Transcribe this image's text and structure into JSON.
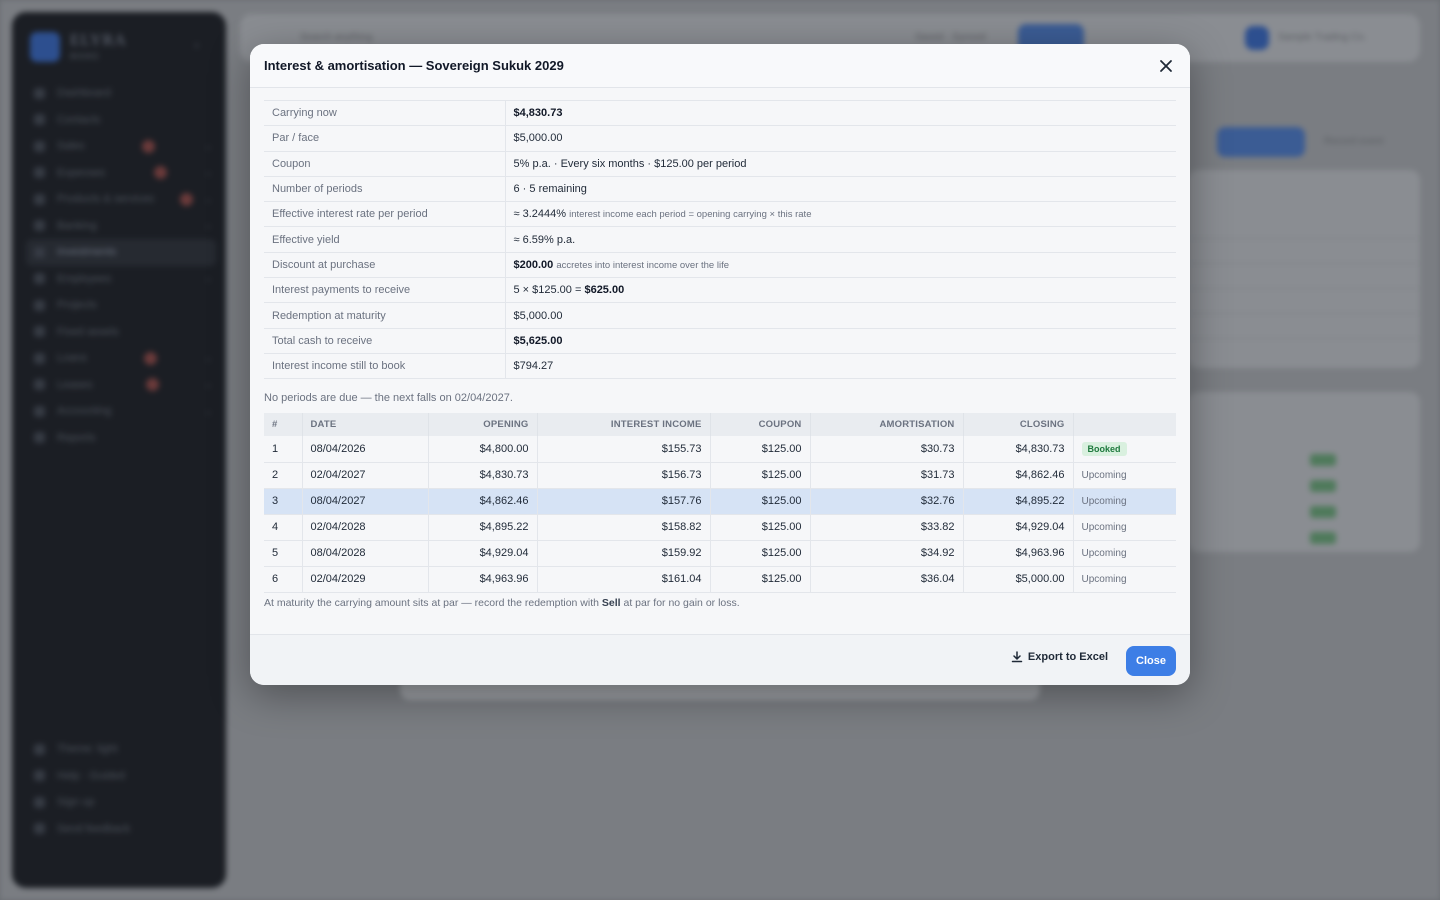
{
  "background": {
    "brand": "ELYRA",
    "brand_sub": "BOOKS",
    "nav": [
      "Dashboard",
      "Contacts",
      "Sales",
      "Expenses",
      "Products & services",
      "Banking",
      "Investments",
      "Employees",
      "Projects",
      "Fixed assets",
      "Loans",
      "Leases",
      "Accounting",
      "Reports"
    ],
    "nav_bottom": [
      "Theme: light",
      "Help · Guided",
      "Sign up",
      "Send feedback"
    ],
    "topbar": {
      "search_placeholder": "Search anything",
      "saved_text": "Saved · Synced",
      "new_label": "+ New",
      "company": "Sample Trading Co."
    },
    "actions": {
      "purchase_label": "Purchase",
      "record_label": "Record event"
    }
  },
  "modal": {
    "title": "Interest & amortisation — Sovereign Sukuk 2029",
    "summary": {
      "carrying_now": {
        "label": "Carrying now",
        "value": "$4,830.73"
      },
      "par": {
        "label": "Par / face",
        "value": "$5,000.00"
      },
      "coupon": {
        "label": "Coupon",
        "value": "5% p.a. · Every six months · $125.00 per period"
      },
      "periods": {
        "label": "Number of periods",
        "value": "6 · 5 remaining"
      },
      "eir": {
        "label": "Effective interest rate per period",
        "value": "≈ 3.2444%",
        "note": "interest income each period = opening carrying × this rate"
      },
      "yield": {
        "label": "Effective yield",
        "value": "≈ 6.59% p.a."
      },
      "discount": {
        "label": "Discount at purchase",
        "value": "$200.00",
        "note": "accretes into interest income over the life"
      },
      "interest_payments": {
        "label": "Interest payments to receive",
        "value_prefix": "5 × $125.00 = ",
        "value_bold": "$625.00"
      },
      "redemption": {
        "label": "Redemption at maturity",
        "value": "$5,000.00"
      },
      "total_cash": {
        "label": "Total cash to receive",
        "value": "$5,625.00"
      },
      "interest_to_book": {
        "label": "Interest income still to book",
        "value": "$794.27"
      }
    },
    "due_line": "No periods are due — the next falls on 02/04/2027.",
    "schedule": {
      "headers": [
        "#",
        "Date",
        "Opening",
        "Interest income",
        "Coupon",
        "Amortisation",
        "Closing",
        ""
      ],
      "rows": [
        {
          "n": "1",
          "date": "08/04/2026",
          "opening": "$4,800.00",
          "interest": "$155.73",
          "coupon": "$125.00",
          "amort": "$30.73",
          "closing": "$4,830.73",
          "status": "Booked"
        },
        {
          "n": "2",
          "date": "02/04/2027",
          "opening": "$4,830.73",
          "interest": "$156.73",
          "coupon": "$125.00",
          "amort": "$31.73",
          "closing": "$4,862.46",
          "status": "Upcoming"
        },
        {
          "n": "3",
          "date": "08/04/2027",
          "opening": "$4,862.46",
          "interest": "$157.76",
          "coupon": "$125.00",
          "amort": "$32.76",
          "closing": "$4,895.22",
          "status": "Upcoming"
        },
        {
          "n": "4",
          "date": "02/04/2028",
          "opening": "$4,895.22",
          "interest": "$158.82",
          "coupon": "$125.00",
          "amort": "$33.82",
          "closing": "$4,929.04",
          "status": "Upcoming"
        },
        {
          "n": "5",
          "date": "08/04/2028",
          "opening": "$4,929.04",
          "interest": "$159.92",
          "coupon": "$125.00",
          "amort": "$34.92",
          "closing": "$4,963.96",
          "status": "Upcoming"
        },
        {
          "n": "6",
          "date": "02/04/2029",
          "opening": "$4,963.96",
          "interest": "$161.04",
          "coupon": "$125.00",
          "amort": "$36.04",
          "closing": "$5,000.00",
          "status": "Upcoming"
        }
      ]
    },
    "footnote": {
      "pre": "At maturity the carrying amount sits at par — record the redemption with ",
      "bold": "Sell",
      "post": " at par for no gain or loss."
    },
    "footer": {
      "export_label": "Export to Excel",
      "close_label": "Close"
    }
  },
  "colors": {
    "accent": "#3d7ee6",
    "booked_bg": "#d9f0df",
    "booked_text": "#1f7a3e",
    "highlight_row": "#d6e3f5"
  }
}
